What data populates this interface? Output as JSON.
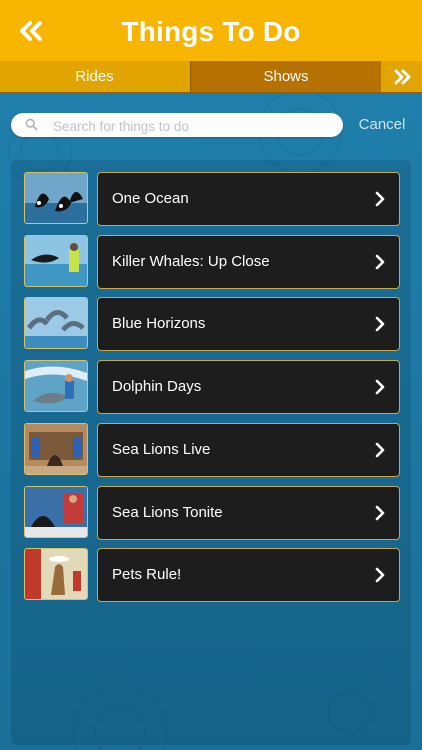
{
  "header": {
    "title": "Things To Do",
    "back_icon": "double-chevron-left-icon"
  },
  "tabs": [
    {
      "label": "Rides",
      "selected": false
    },
    {
      "label": "Shows",
      "selected": true
    }
  ],
  "search": {
    "placeholder": "Search for things to do",
    "value": "",
    "cancel_label": "Cancel"
  },
  "items": [
    {
      "label": "One Ocean"
    },
    {
      "label": "Killer Whales: Up Close"
    },
    {
      "label": "Blue Horizons"
    },
    {
      "label": "Dolphin Days"
    },
    {
      "label": "Sea Lions Live"
    },
    {
      "label": "Sea Lions Tonite"
    },
    {
      "label": "Pets Rule!"
    }
  ],
  "colors": {
    "header": "#f7b500",
    "tab_selected": "#b77100",
    "background": "#1d78a3",
    "card": "#1d1d1d",
    "card_border": "#c8a84a"
  }
}
